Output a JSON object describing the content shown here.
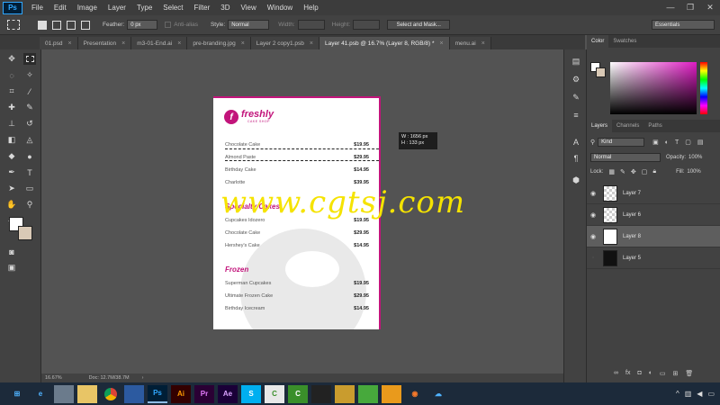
{
  "app": {
    "logo": "Ps"
  },
  "menu": [
    "File",
    "Edit",
    "Image",
    "Layer",
    "Type",
    "Select",
    "Filter",
    "3D",
    "View",
    "Window",
    "Help"
  ],
  "window_controls": [
    "—",
    "❐",
    "✕"
  ],
  "options": {
    "feather_label": "Feather:",
    "feather_value": "0 px",
    "antialias_label": "Anti-alias",
    "style_label": "Style:",
    "style_value": "Normal",
    "width_label": "Width:",
    "height_label": "Height:",
    "select_mask": "Select and Mask...",
    "workspace": "Essentials"
  },
  "tabs": [
    {
      "label": "01.psd",
      "active": false
    },
    {
      "label": "Presentation",
      "active": false
    },
    {
      "label": "m3-01-End.ai",
      "active": false
    },
    {
      "label": "pre-branding.jpg",
      "active": false
    },
    {
      "label": "Layer 2 copy1.psb",
      "active": false
    },
    {
      "label": "Layer 41.psb @ 16.7% (Layer 8, RGB/8) *",
      "active": true
    },
    {
      "label": "menu.ai",
      "active": false
    }
  ],
  "document": {
    "brand_name": "freshly",
    "brand_sub": "CAKE SHOP",
    "items_top": [
      {
        "name": "Chocolate Cake",
        "price": "$19.95"
      },
      {
        "name": "Almond Paste",
        "price": "$29.95"
      },
      {
        "name": "Birthday Cake",
        "price": "$14.95"
      },
      {
        "name": "Charlotte",
        "price": "$39.95"
      }
    ],
    "section2_title": "Specialty Cakes",
    "items_mid": [
      {
        "name": "Cupcakes Idozero",
        "price": "$19.95"
      },
      {
        "name": "Chocolate Cake",
        "price": "$29.95"
      },
      {
        "name": "Hershey's Cake",
        "price": "$14.95"
      }
    ],
    "section3_title": "Frozen",
    "items_bottom": [
      {
        "name": "Superman Cupcakes",
        "price": "$19.95"
      },
      {
        "name": "Ultimate Frozen Cake",
        "price": "$29.95"
      },
      {
        "name": "Birthday Icecream",
        "price": "$14.95"
      }
    ]
  },
  "measure": {
    "w": "W :   1656 px",
    "h": "H :     133 px"
  },
  "watermark": "www.cgtsj.com",
  "status": {
    "zoom": "16.67%",
    "doc": "Doc: 12.7M/38.7M"
  },
  "color_panel": {
    "tabs": [
      "Color",
      "Swatches"
    ]
  },
  "layers_panel": {
    "tabs": [
      "Layers",
      "Channels",
      "Paths"
    ],
    "filter": "Kind",
    "blend": "Normal",
    "opacity_label": "Opacity:",
    "opacity": "100%",
    "lock_label": "Lock:",
    "fill_label": "Fill:",
    "fill": "100%",
    "layers": [
      {
        "name": "Layer 7",
        "visible": true,
        "selected": false
      },
      {
        "name": "Layer 6",
        "visible": true,
        "selected": false
      },
      {
        "name": "Layer 8",
        "visible": true,
        "selected": true
      },
      {
        "name": "Layer 5",
        "visible": false,
        "selected": false
      }
    ]
  },
  "colors": {
    "accent": "#c2147b",
    "watermark": "#f5e300",
    "panel_bg": "#424242",
    "canvas_bg": "#535353"
  }
}
